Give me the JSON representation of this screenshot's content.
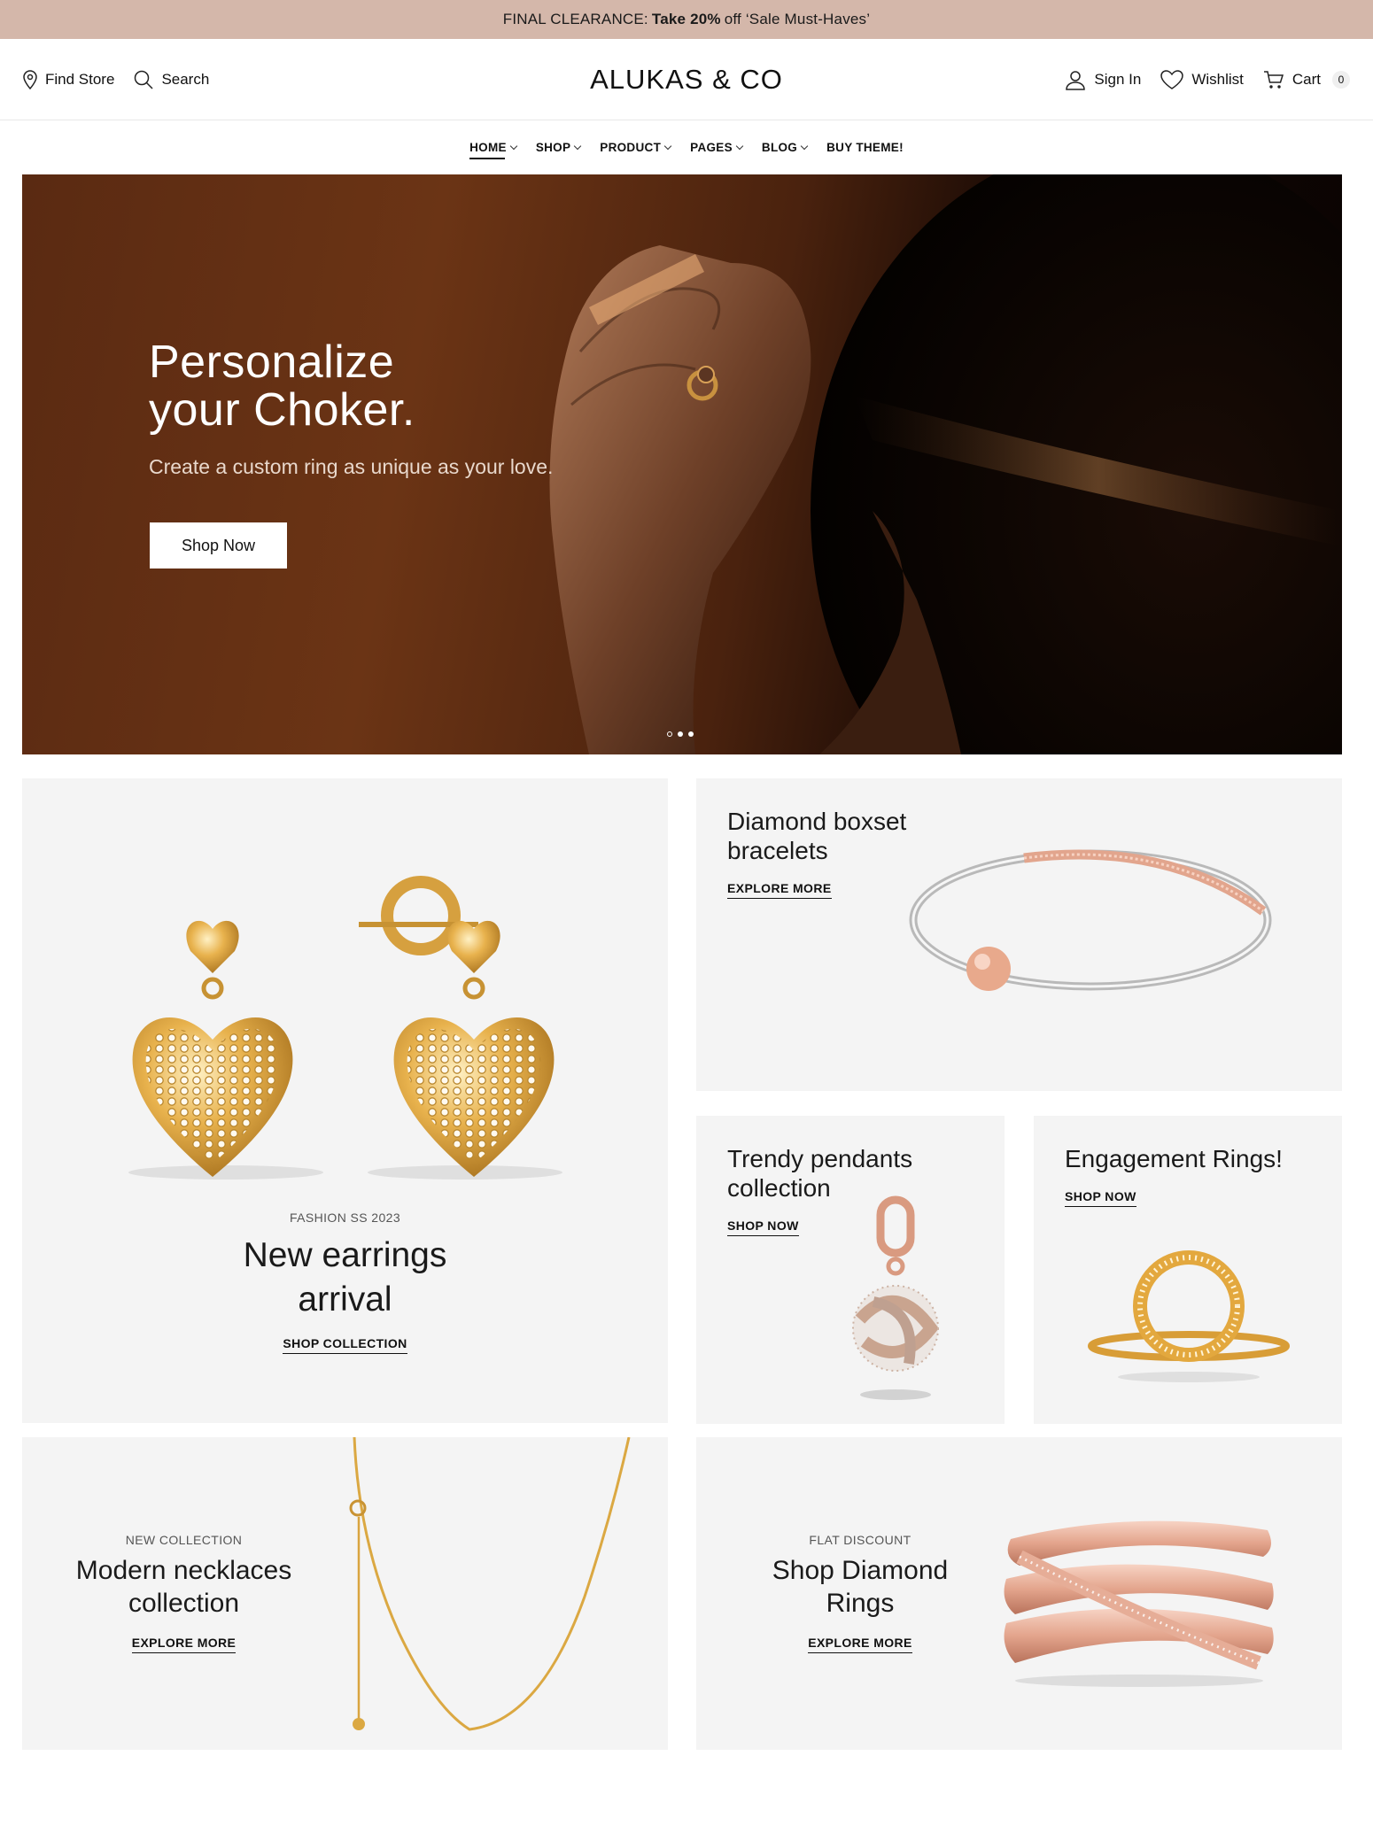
{
  "announcement": {
    "prefix": "FINAL CLEARANCE:",
    "bold": "Take 20%",
    "suffix": "off ‘Sale Must-Haves’"
  },
  "header": {
    "find_store": "Find Store",
    "search": "Search",
    "logo": "ALUKAS & CO",
    "sign_in": "Sign In",
    "wishlist": "Wishlist",
    "cart": "Cart",
    "cart_count": "0"
  },
  "nav": {
    "items": [
      {
        "label": "HOME",
        "active": true,
        "dropdown": true
      },
      {
        "label": "SHOP",
        "dropdown": true
      },
      {
        "label": "PRODUCT",
        "dropdown": true
      },
      {
        "label": "PAGES",
        "dropdown": true
      },
      {
        "label": "BLOG",
        "dropdown": true
      },
      {
        "label": "BUY THEME!",
        "dropdown": false
      }
    ]
  },
  "hero": {
    "title_line1": "Personalize",
    "title_line2": "your Choker.",
    "subtitle": "Create a custom ring as unique as your love.",
    "button": "Shop Now",
    "slides": 3,
    "active_slide": 1
  },
  "tiles": {
    "earrings": {
      "eyebrow": "FASHION SS 2023",
      "title_line1": "New earrings",
      "title_line2": "arrival",
      "link": "SHOP COLLECTION"
    },
    "bracelets": {
      "title_line1": "Diamond boxset",
      "title_line2": "bracelets",
      "link": "EXPLORE MORE"
    },
    "pendants": {
      "title_line1": "Trendy pendants",
      "title_line2": "collection",
      "link": "SHOP NOW"
    },
    "engagement": {
      "title": "Engagement Rings!",
      "link": "SHOP NOW"
    },
    "necklaces": {
      "eyebrow": "NEW COLLECTION",
      "title_line1": "Modern necklaces",
      "title_line2": "collection",
      "link": "EXPLORE MORE"
    },
    "rings": {
      "eyebrow": "FLAT DISCOUNT",
      "title_line1": "Shop Diamond",
      "title_line2": "Rings",
      "link": "EXPLORE MORE"
    }
  },
  "colors": {
    "announcement_bg": "#d4b7aa",
    "tile_bg": "#f4f4f4",
    "gold": "#e0a93b",
    "rose_gold": "#e7b29e"
  }
}
